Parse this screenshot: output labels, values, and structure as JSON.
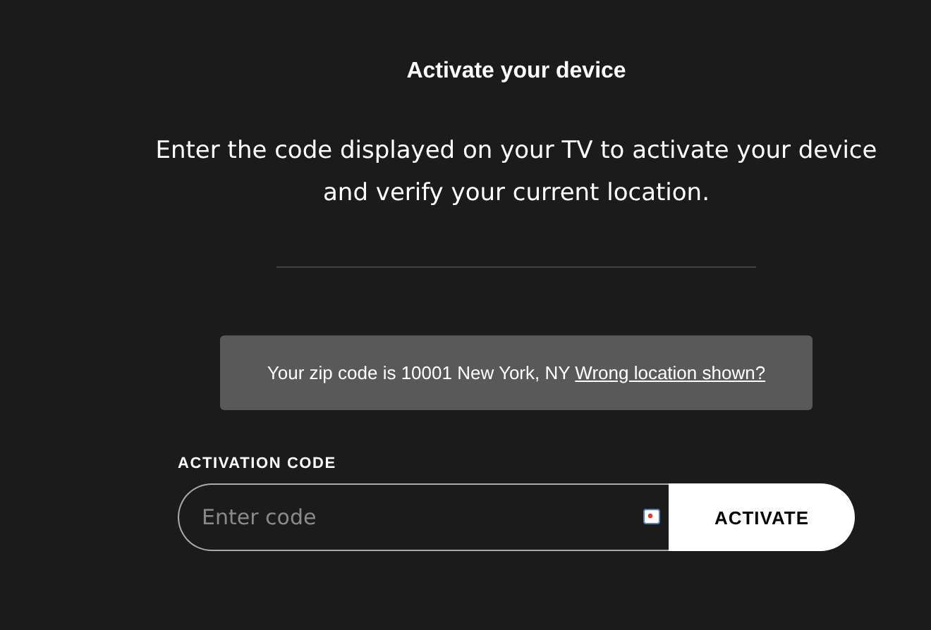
{
  "title": "Activate your device",
  "instructions": "Enter the code displayed on your TV to activate your device and verify your current location.",
  "location_notice": {
    "text": "Your zip code is 10001 New York, NY",
    "link": "Wrong location shown?"
  },
  "activation": {
    "label": "ACTIVATION CODE",
    "placeholder": "Enter code",
    "button": "ACTIVATE"
  }
}
